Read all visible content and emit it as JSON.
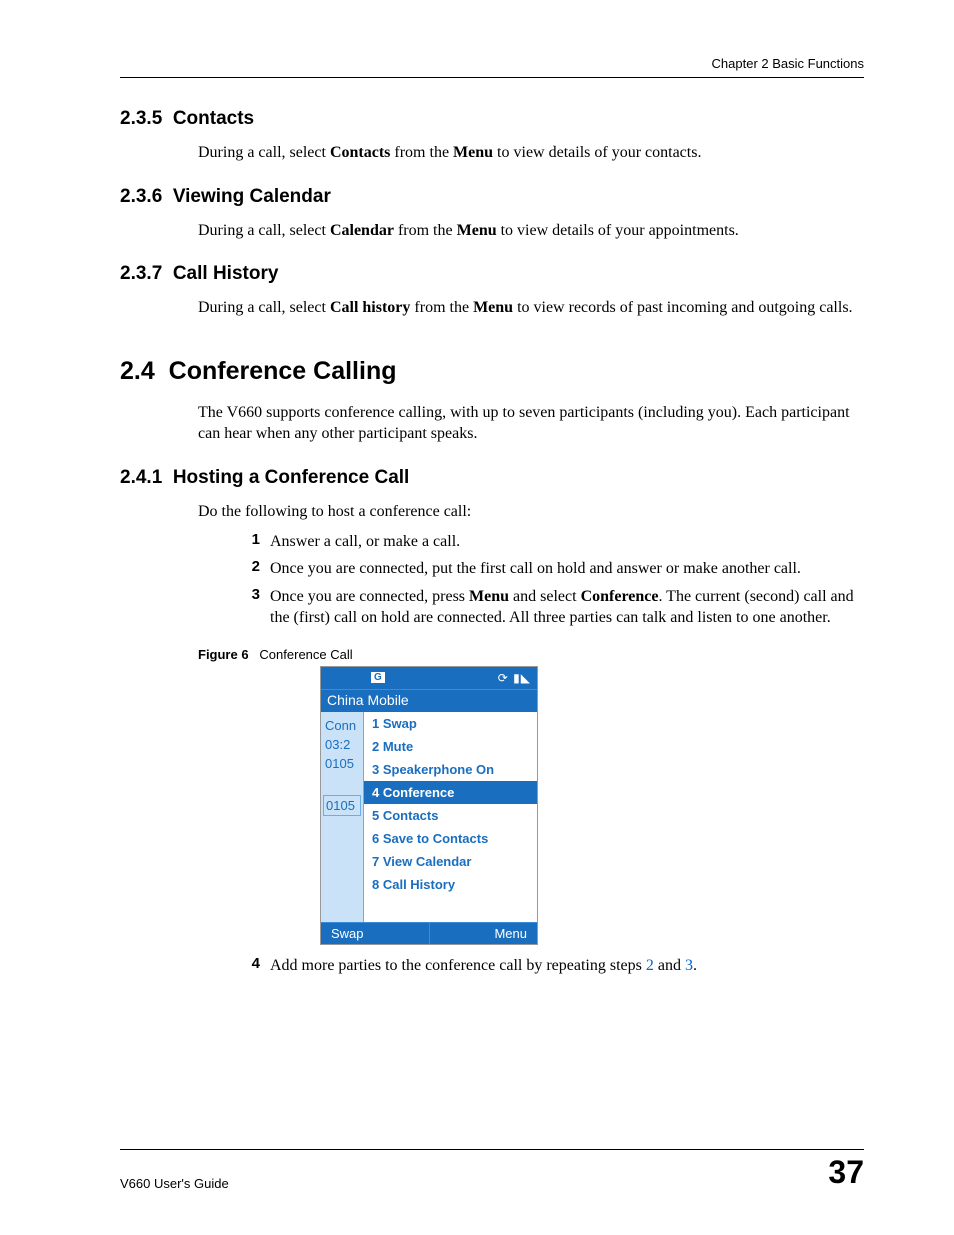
{
  "header": {
    "chapter": "Chapter 2 Basic Functions"
  },
  "sections": {
    "s235": {
      "num": "2.3.5",
      "title": "Contacts",
      "body_pre": "During a call, select ",
      "body_b1": "Contacts",
      "body_mid": " from the ",
      "body_b2": "Menu",
      "body_post": " to view details of your contacts."
    },
    "s236": {
      "num": "2.3.6",
      "title": "Viewing Calendar",
      "body_pre": "During a call, select ",
      "body_b1": "Calendar",
      "body_mid": " from the ",
      "body_b2": "Menu",
      "body_post": " to view details of your appointments."
    },
    "s237": {
      "num": "2.3.7",
      "title": "Call History",
      "body_pre": "During a call, select ",
      "body_b1": "Call history",
      "body_mid": " from the ",
      "body_b2": "Menu",
      "body_post": " to view records of past incoming and outgoing calls."
    },
    "s24": {
      "num": "2.4",
      "title": "Conference Calling",
      "body": "The V660 supports conference calling, with up to seven participants (including you). Each participant can hear when any other participant speaks."
    },
    "s241": {
      "num": "2.4.1",
      "title": "Hosting a Conference Call",
      "intro": "Do the following to host a conference call:",
      "steps": {
        "n1": "1",
        "t1": "Answer a call, or make a call.",
        "n2": "2",
        "t2": "Once you are connected, put the first call on hold and answer or make another call.",
        "n3": "3",
        "t3_pre": "Once you are connected, press ",
        "t3_b1": "Menu",
        "t3_mid": " and select ",
        "t3_b2": "Conference",
        "t3_post": ". The current (second) call and the (first) call on hold are connected. All three parties can talk and listen to one another.",
        "n4": "4",
        "t4_pre": "Add more parties to the conference call by repeating steps ",
        "t4_link2": "2",
        "t4_and": " and ",
        "t4_link3": "3",
        "t4_post": "."
      }
    }
  },
  "figure": {
    "label": "Figure 6",
    "caption": "Conference Call",
    "phone": {
      "gprs": "G",
      "carrier": "China Mobile",
      "left": {
        "status": "Conn",
        "time": "03:2",
        "num1": "0105",
        "num2": "0105"
      },
      "menu": [
        "1 Swap",
        "2 Mute",
        "3 Speakerphone On",
        "4 Conference",
        "5 Contacts",
        "6 Save to Contacts",
        "7 View Calendar",
        "8 Call History"
      ],
      "selected_index": 3,
      "softkeys": {
        "left": "Swap",
        "right": "Menu"
      }
    }
  },
  "footer": {
    "guide": "V660 User's Guide",
    "page": "37"
  }
}
